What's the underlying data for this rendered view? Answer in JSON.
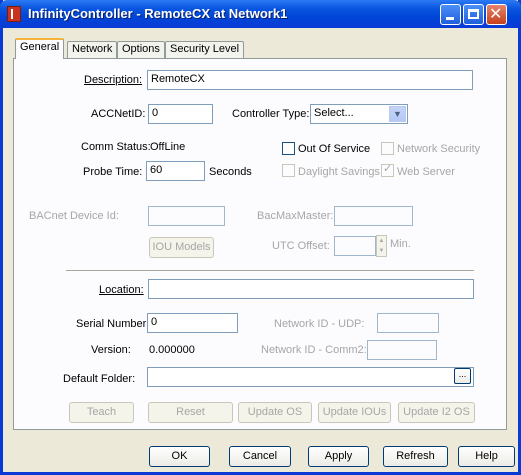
{
  "window": {
    "title": "InfinityController - RemoteCX at Network1",
    "minimize_glyph": "",
    "maximize_glyph": "",
    "close_glyph": "✕"
  },
  "tabs": [
    "General",
    "Network",
    "Options",
    "Security Level"
  ],
  "general": {
    "description_label": "Description:",
    "description_value": "RemoteCX",
    "accnetid_label": "ACCNetID:",
    "accnetid_value": "0",
    "controller_type_label": "Controller Type:",
    "controller_type_value": "Select...",
    "comm_status_label": "Comm Status:",
    "comm_status_value": "OffLine",
    "out_of_service_label": "Out Of Service",
    "network_security_label": "Network Security",
    "probe_time_label": "Probe Time:",
    "probe_time_value": "60",
    "probe_time_unit": "Seconds",
    "daylight_savings_label": "Daylight Savings",
    "web_server_label": "Web Server",
    "web_server_checked": true,
    "bacnet_device_id_label": "BACnet Device Id:",
    "bacmaxmaster_label": "BacMaxMaster:",
    "iou_models_label": "IOU Models",
    "utc_offset_label": "UTC Offset:",
    "utc_unit": "Min.",
    "location_label": "Location:",
    "location_value": "",
    "serial_number_label": "Serial Number:",
    "serial_number_value": "0",
    "network_id_udp_label": "Network ID - UDP:",
    "version_label": "Version:",
    "version_value": "0.000000",
    "network_id_comm2_label": "Network ID - Comm2:",
    "default_folder_label": "Default Folder:",
    "default_folder_value": ""
  },
  "action_buttons": [
    "Teach",
    "Reset",
    "Update OS",
    "Update IOUs",
    "Update I2 OS"
  ],
  "dialog_buttons": [
    "OK",
    "Cancel",
    "Apply",
    "Refresh",
    "Help"
  ]
}
